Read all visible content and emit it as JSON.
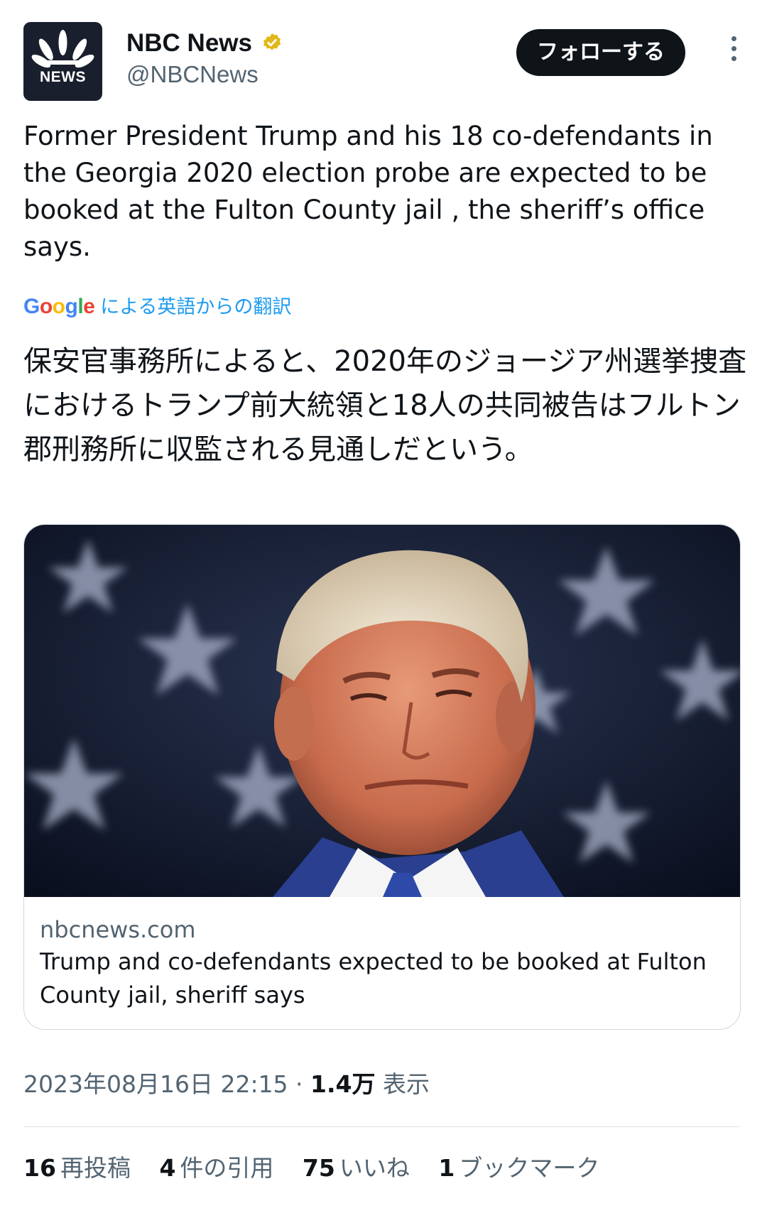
{
  "author": {
    "avatar_text": "NEWS",
    "display_name": "NBC News",
    "handle": "@NBCNews",
    "verified_badge_icon": "verified-gold-badge",
    "verified_color": "#e2b719"
  },
  "actions": {
    "follow_label": "フォローする",
    "more_icon": "more-vertical-icon"
  },
  "tweet": {
    "text": "Former President Trump and his 18 co-defendants in the Georgia 2020 election probe are expected to be booked at the Fulton County jail , the sheriff’s office says.",
    "translation_brand": "Google",
    "translation_label": "による英語からの翻訳",
    "translated_text": "保安官事務所によると、2020年のジョージア州選挙捜査におけるトランプ前大統領と18人の共同被告はフルトン郡刑務所に収監される見通しだという。"
  },
  "card": {
    "domain": "nbcnews.com",
    "title": "Trump and co-defendants expected to be booked at Fulton County jail, sheriff says"
  },
  "meta": {
    "timestamp": "2023年08月16日 22:15",
    "separator": " · ",
    "views_count": "1.4万",
    "views_label": " 表示"
  },
  "stats": [
    {
      "count": "16",
      "label": "再投稿"
    },
    {
      "count": "4",
      "label": "件の引用"
    },
    {
      "count": "75",
      "label": "いいね"
    },
    {
      "count": "1",
      "label": "ブックマーク"
    }
  ],
  "colors": {
    "accent": "#1d9bf0",
    "text": "#0f1419",
    "secondary": "#536471",
    "follow_bg": "#0f1419"
  }
}
